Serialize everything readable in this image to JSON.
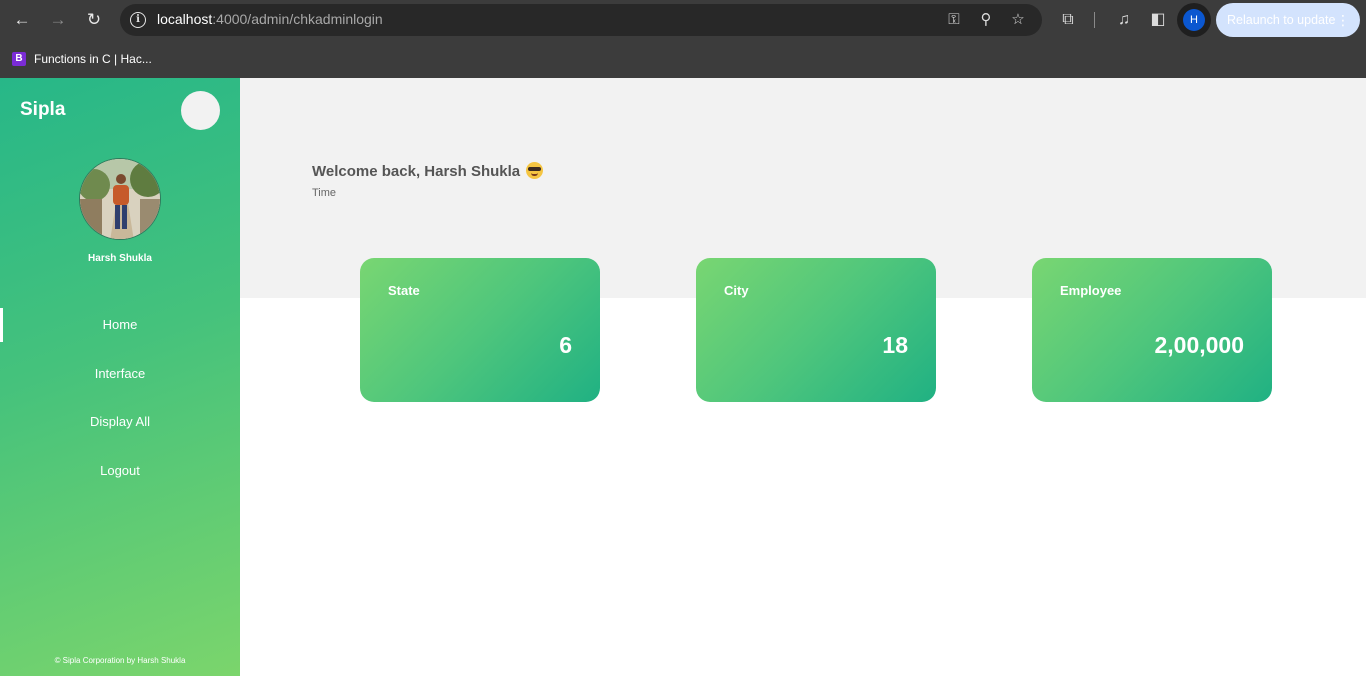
{
  "browser": {
    "url_host": "localhost",
    "url_path": ":4000/admin/chkadminlogin",
    "profile_initial": "H",
    "relaunch_label": "Relaunch to update",
    "bookmarks": [
      {
        "favicon": "B",
        "label": "Functions in C | Hac..."
      }
    ]
  },
  "sidebar": {
    "brand": "Sipla",
    "user_name": "Harsh Shukla",
    "nav_items": [
      {
        "label": "Home",
        "active": true
      },
      {
        "label": "Interface",
        "active": false
      },
      {
        "label": "Display All",
        "active": false
      },
      {
        "label": "Logout",
        "active": false
      }
    ],
    "footer": "© Sipla Corporation by Harsh Shukla"
  },
  "main": {
    "welcome": "Welcome back, Harsh Shukla",
    "time_label": "Time",
    "cards": [
      {
        "title": "State",
        "value": "6"
      },
      {
        "title": "City",
        "value": "18"
      },
      {
        "title": "Employee",
        "value": "2,00,000"
      }
    ]
  },
  "colors": {
    "sidebar_gradient_start": "#27b788",
    "sidebar_gradient_end": "#7bd56c",
    "card_gradient_start": "#79d672",
    "card_gradient_end": "#20b183",
    "hero_background": "#f2f2f2"
  },
  "icons": [
    "back-arrow-icon",
    "forward-arrow-icon",
    "reload-icon",
    "site-info-icon",
    "key-icon",
    "zoom-icon",
    "bookmark-star-icon",
    "extensions-icon",
    "media-icon",
    "side-panel-icon",
    "kebab-menu-icon",
    "sunglasses-emoji-icon"
  ]
}
